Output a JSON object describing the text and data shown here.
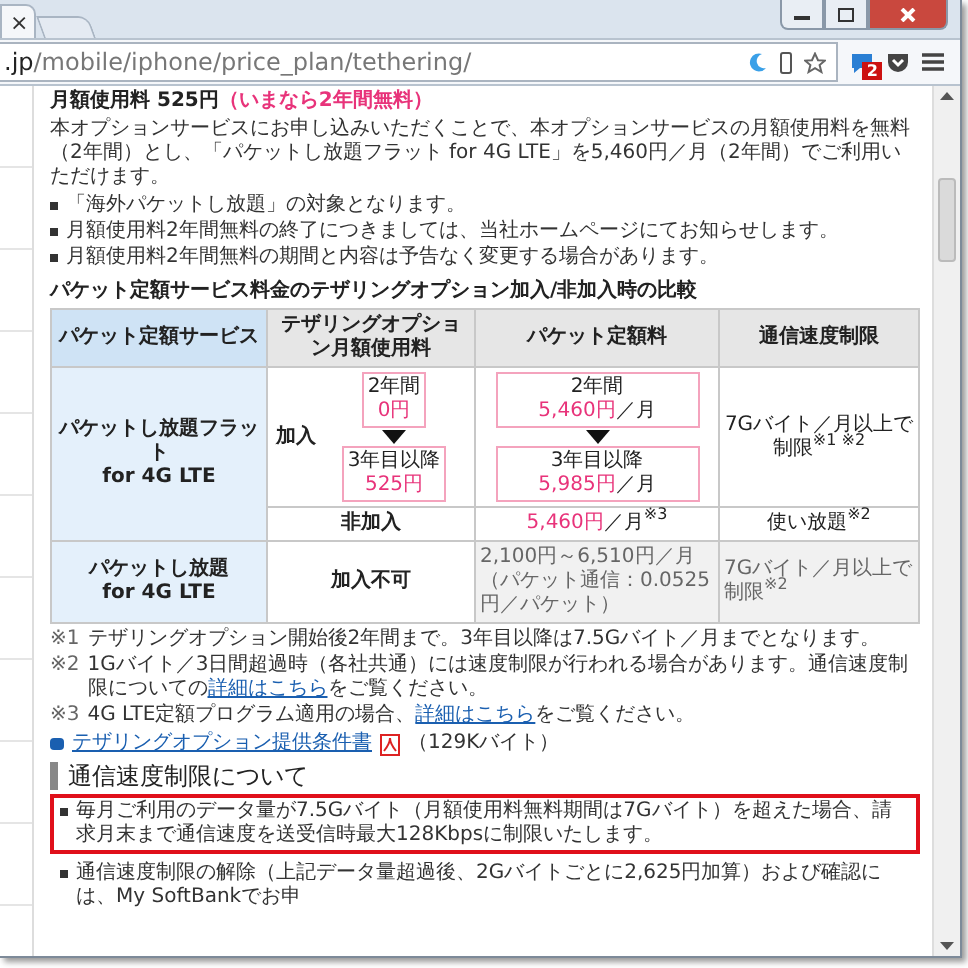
{
  "browser": {
    "tabs": [
      {
        "close": "×",
        "selected": true
      },
      {
        "selected": false
      }
    ],
    "url": {
      "host": ".jp",
      "path": "/mobile/iphone/price_plan/tethering/"
    },
    "extension_badge": "2"
  },
  "price_heading": {
    "label": "月額使用料 525円",
    "note": "（いまなら2年間無料）"
  },
  "intro": "本オプションサービスにお申し込みいただくことで、本オプションサービスの月額使用料を無料（2年間）とし、「パケットし放題フラット for 4G LTE」を5,460円／月（2年間）でご利用いただけます。",
  "bullets": [
    "「海外パケットし放題」の対象となります。",
    "月額使用料2年間無料の終了につきましては、当社ホームページにてお知らせします。",
    "月額使用料2年間無料の期間と内容は予告なく変更する場合があります。"
  ],
  "table": {
    "title": "パケット定額サービス料金のテザリングオプション加入/非加入時の比較",
    "columns": [
      "パケット定額サービス",
      "テザリングオプション月額使用料",
      "パケット定額料",
      "通信速度制限"
    ],
    "rows": [
      {
        "name": "パケットし放題フラット",
        "sub": "for 4G LTE",
        "plans": [
          {
            "kind": "boxes",
            "status": "加入",
            "fee_boxes": [
              {
                "period": "2年間",
                "price": "0円"
              },
              {
                "period": "3年目以降",
                "price": "525円"
              }
            ],
            "packet_boxes": [
              {
                "period": "2年間",
                "price": "5,460円",
                "unit": "／月"
              },
              {
                "period": "3年目以降",
                "price": "5,985円",
                "unit": "／月"
              }
            ],
            "limit": "7Gバイト／月以上で制限$^{※1 ※2}$"
          },
          {
            "kind": "single",
            "status": "非加入",
            "price": "5,460円",
            "unit": "／月$^{※3}$",
            "limit": "使い放題$^{※2}$"
          }
        ]
      },
      {
        "name": "パケットし放題",
        "sub": "for 4G LTE",
        "plans": [
          {
            "kind": "range",
            "status": "加入不可",
            "price": "2,100円～6,510円／月",
            "price_note": "（パケット通信：0.0525円／パケット）",
            "limit": "7Gバイト／月以上で制限$^{※2}$",
            "greyed": true
          }
        ]
      }
    ]
  },
  "notes": [
    {
      "mark": "※1",
      "text": "テザリングオプション開始後2年間まで。3年目以降は7.5Gバイト／月までとなります。"
    },
    {
      "mark": "※2",
      "text": "1Gバイト／3日間超過時（各社共通）には速度制限が行われる場合があります。通信速度制限についての",
      "link": "詳細はこちら",
      "after": "をご覧ください。"
    },
    {
      "mark": "※3",
      "text": "4G LTE定額プログラム適用の場合、",
      "link": "詳細はこちら",
      "after": "をご覧ください。"
    }
  ],
  "doc_link": {
    "label": "テザリングオプション提供条件書",
    "size": "（129Kバイト）"
  },
  "section": {
    "title": "通信速度制限について",
    "items": [
      {
        "text": "毎月ご利用のデータ量が7.5Gバイト（月額使用料無料期間は7Gバイト）を超えた場合、請求月末まで通信速度を送受信時最大128Kbpsに制限いたします。",
        "highlighted": true
      },
      {
        "text": "通信速度制限の解除（上記データ量超過後、2Gバイトごとに2,625円加算）および確認には、My SoftBankでお申",
        "highlighted": false
      }
    ]
  }
}
